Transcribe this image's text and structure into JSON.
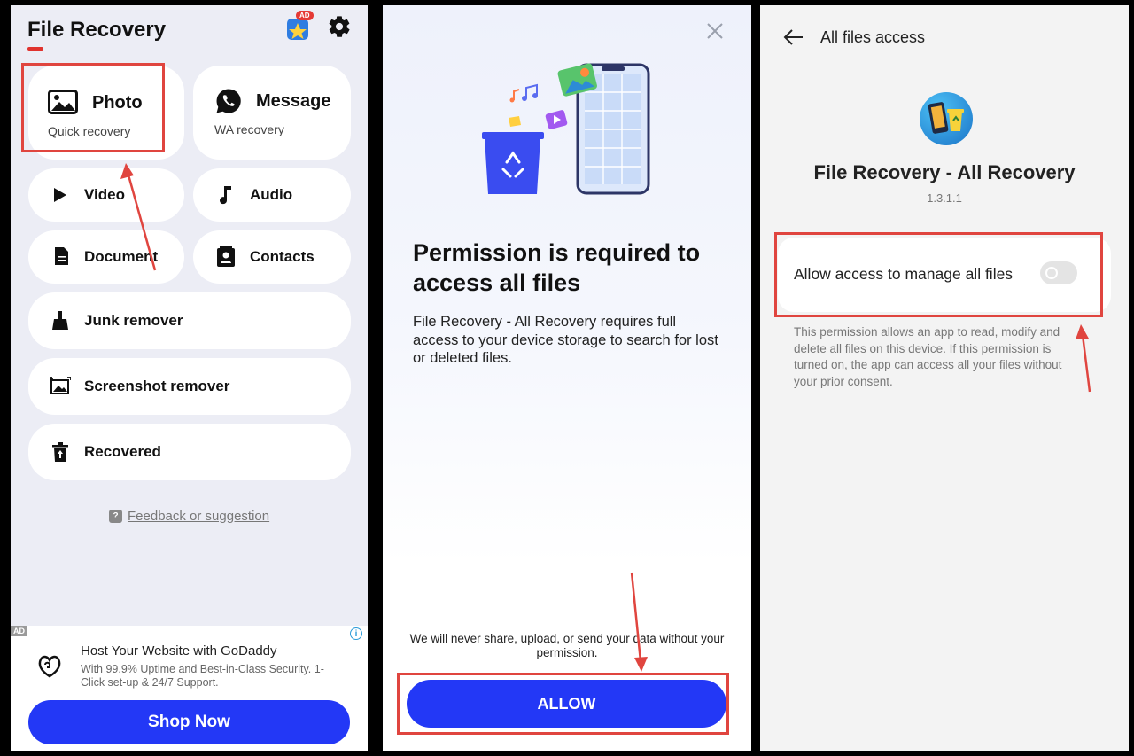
{
  "colors": {
    "accent_blue": "#2338f6",
    "highlight_red": "#e0453f",
    "title_underline": "#e0332e"
  },
  "panel1": {
    "app_title": "File Recovery",
    "ad_badge": "AD",
    "cards": {
      "photo": {
        "label": "Photo",
        "sub": "Quick recovery",
        "icon": "image-icon"
      },
      "message": {
        "label": "Message",
        "sub": "WA recovery",
        "icon": "whatsapp-icon"
      },
      "video": {
        "label": "Video",
        "icon": "play-icon"
      },
      "audio": {
        "label": "Audio",
        "icon": "music-note-icon"
      },
      "document": {
        "label": "Document",
        "icon": "document-icon"
      },
      "contacts": {
        "label": "Contacts",
        "icon": "contact-card-icon"
      },
      "junk": {
        "label": "Junk remover",
        "icon": "broom-icon"
      },
      "screenshot": {
        "label": "Screenshot remover",
        "icon": "screenshot-icon"
      },
      "recovered": {
        "label": "Recovered",
        "icon": "trash-restore-icon"
      }
    },
    "feedback": "Feedback or suggestion",
    "ad": {
      "tag": "AD",
      "title": "Host Your Website with GoDaddy",
      "body": "With 99.9% Uptime and Best-in-Class Security. 1-Click set-up & 24/7 Support.",
      "cta": "Shop Now"
    }
  },
  "panel2": {
    "title": "Permission is required to access all files",
    "body": "File Recovery - All Recovery requires full access to your device storage to search for lost or deleted files.",
    "privacy": "We will never share, upload, or send your data without your permission.",
    "allow": "ALLOW"
  },
  "panel3": {
    "header": "All files access",
    "app_name": "File Recovery - All Recovery",
    "version": "1.3.1.1",
    "setting_label": "Allow access to manage all files",
    "toggle_on": false,
    "description": "This permission allows an app to read, modify and delete all files on this device. If this permission is turned on, the app can access all your files without your prior consent."
  }
}
